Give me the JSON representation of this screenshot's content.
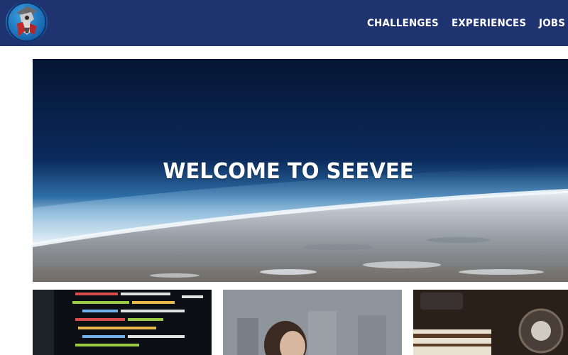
{
  "nav": {
    "links": [
      "CHALLENGES",
      "EXPERIENCES",
      "JOBS"
    ]
  },
  "hero": {
    "title": "WELCOME TO SEEVEE"
  },
  "colors": {
    "navbar": "#1f3370",
    "hero_title": "#ffffff",
    "page_background": "#ffffff"
  },
  "icons": {
    "logo": "mascot-logo-icon"
  }
}
